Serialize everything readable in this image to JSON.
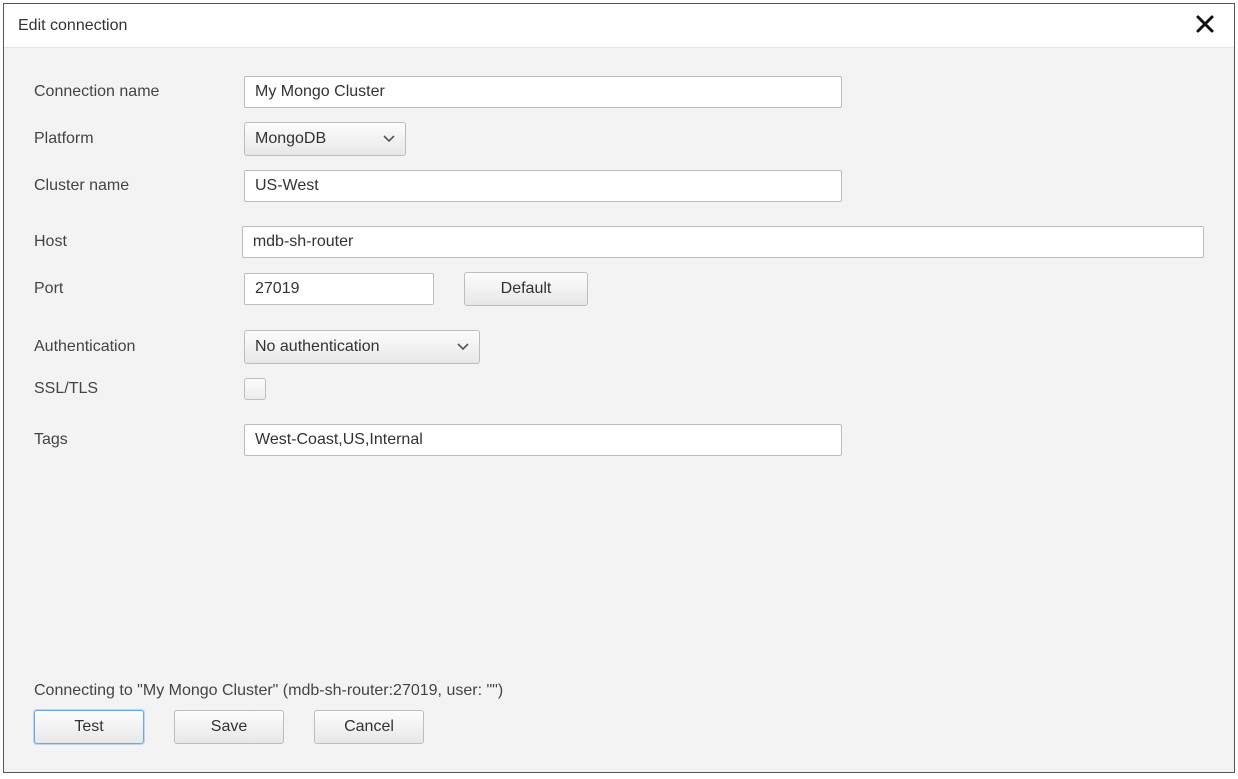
{
  "dialog": {
    "title": "Edit connection"
  },
  "labels": {
    "connection_name": "Connection name",
    "platform": "Platform",
    "cluster_name": "Cluster name",
    "host": "Host",
    "port": "Port",
    "default_button": "Default",
    "authentication": "Authentication",
    "ssl_tls": "SSL/TLS",
    "tags": "Tags"
  },
  "values": {
    "connection_name": "My Mongo Cluster",
    "platform": "MongoDB",
    "cluster_name": "US-West",
    "host": "mdb-sh-router",
    "port": "27019",
    "authentication": "No authentication",
    "ssl_tls_checked": false,
    "tags": "West-Coast,US,Internal"
  },
  "footer": {
    "status": "Connecting to \"My Mongo Cluster\" (mdb-sh-router:27019, user: \"\")",
    "buttons": {
      "test": "Test",
      "save": "Save",
      "cancel": "Cancel"
    }
  }
}
